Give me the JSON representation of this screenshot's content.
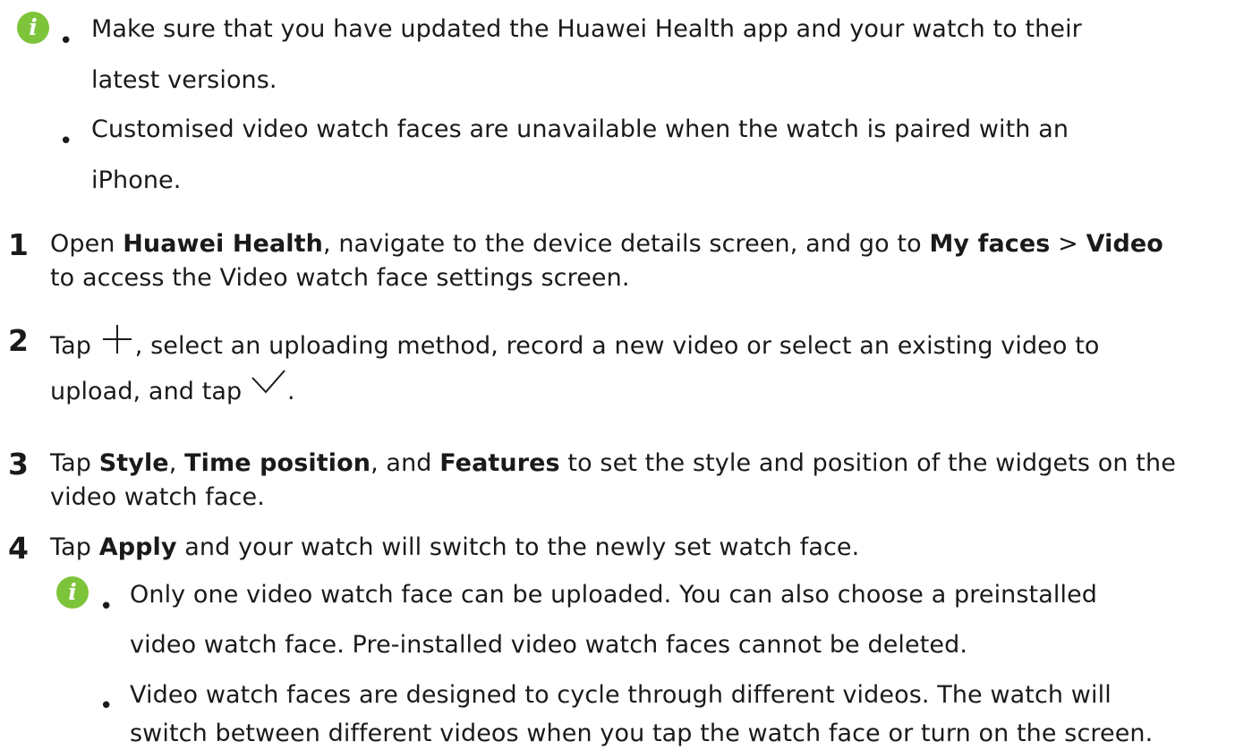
{
  "note1": {
    "icon": "info-icon",
    "bullets": [
      {
        "line1": "Make sure that you have updated the Huawei Health app and your watch to their",
        "line2": "latest versions."
      },
      {
        "line1": "Customised video watch faces are unavailable when the watch is paired with an",
        "line2": "iPhone."
      }
    ]
  },
  "steps": [
    {
      "number": "1",
      "line1": {
        "t1": "Open ",
        "b1": "Huawei Health",
        "t2": ", navigate to the device details screen, and go to ",
        "b2": "My faces",
        "t3": " > ",
        "b3": "Video"
      },
      "line2": "to access the Video watch face settings screen."
    },
    {
      "number": "2",
      "line1": {
        "t1": "Tap ",
        "icon": "plus-icon",
        "t2": ", select an uploading method, record a new video or select an existing video to"
      },
      "line2": {
        "t1": "upload, and tap ",
        "icon": "checkmark-icon",
        "t2": "."
      }
    },
    {
      "number": "3",
      "line1": {
        "t1": "Tap ",
        "b1": "Style",
        "t2": ", ",
        "b2": "Time position",
        "t3": ", and ",
        "b3": "Features",
        "t4": " to set the style and position of the widgets on the"
      },
      "line2": "video watch face."
    },
    {
      "number": "4",
      "line1": {
        "t1": "Tap ",
        "b1": "Apply",
        "t2": " and your watch will switch to the newly set watch face."
      }
    }
  ],
  "note2": {
    "icon": "info-icon",
    "bullets": [
      {
        "line1": "Only one video watch face can be uploaded. You can also choose a preinstalled",
        "line2": "video watch face. Pre-installed video watch faces cannot be deleted."
      },
      {
        "line1": "Video watch faces are designed to cycle through different videos. The watch will",
        "line2": "switch between different videos when you tap the watch face or turn on the screen."
      }
    ]
  },
  "glyphs": {
    "info": "i",
    "bullet": "•"
  },
  "colors": {
    "info_icon": "#7ec43a",
    "text": "#1a1a1a"
  }
}
